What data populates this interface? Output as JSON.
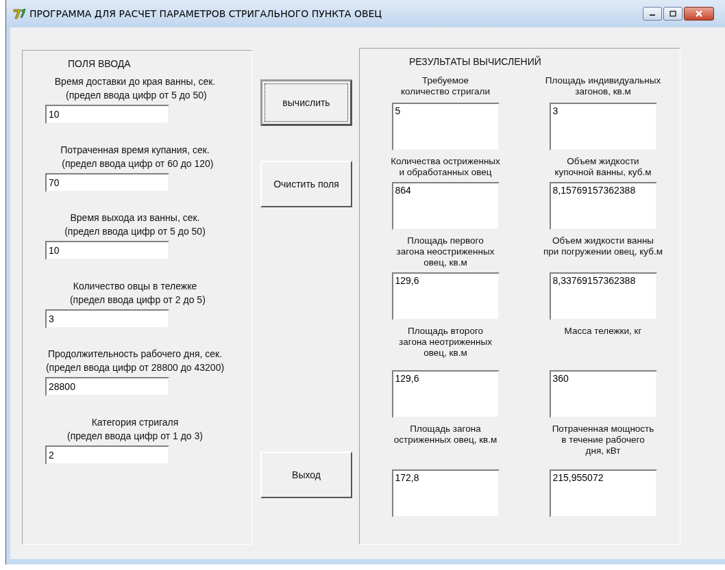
{
  "window": {
    "title": "ПРОГРАММА ДЛЯ РАСЧЕТ ПАРАМЕТРОВ СТРИГАЛЬНОГО ПУНКТА ОВЕЦ"
  },
  "inputs": {
    "title": "ПОЛЯ ВВОДА",
    "fields": [
      {
        "label": "Время доставки до края ванны, сек.\n (предел ввода цифр от 5 до 50)",
        "value": "10"
      },
      {
        "label": "Потраченная время купания, сек.\n  (предел ввода цифр от 60 до 120)",
        "value": "70"
      },
      {
        "label": "Время выхода из ванны, сек.\n(предел ввода цифр от 5 до 50)",
        "value": "10"
      },
      {
        "label": "Количество овцы в тележке\n  (предел ввода цифр от 2 до 5)",
        "value": "3"
      },
      {
        "label": "Продолжительность рабочего дня, сек.\n(предел ввода цифр от 28800 до 43200)",
        "value": "28800"
      },
      {
        "label": "Категория стригаля\n(предел ввода цифр от 1 до 3)",
        "value": "2"
      }
    ]
  },
  "buttons": [
    {
      "label": "вычислить",
      "default": true
    },
    {
      "label": "Очистить поля",
      "default": false
    },
    {
      "label": "Выход",
      "default": false
    }
  ],
  "results": {
    "title": "РЕЗУЛЬТАТЫ ВЫЧИСЛЕНИЙ",
    "items": [
      {
        "label": "Требуемое\nколичество стригали",
        "value": "5"
      },
      {
        "label": "Площадь индивидуальных\nзагонов, кв.м",
        "value": "3"
      },
      {
        "label": "Количества остриженных\nи обработанных овец",
        "value": "864"
      },
      {
        "label": "Объем жидкости\nкупочной ванны, куб.м",
        "value": "8,15769157362388"
      },
      {
        "label": "Площадь первого\nзагона неостриженных\nовец, кв.м",
        "value": "129,6"
      },
      {
        "label": "Объем жидкости ванны\nпри погружении овец, куб.м",
        "value": "8,33769157362388"
      },
      {
        "label": "Площадь второго\nзагона неотриженных\nовец, кв.м",
        "value": "129,6"
      },
      {
        "label": "Масса тележки, кг",
        "value": "360"
      },
      {
        "label": "Площадь загона\nостриженных овец, кв.м",
        "value": "172,8"
      },
      {
        "label": "Потраченная мощность\nв течение рабочего\nдня, кВт",
        "value": "215,955072"
      }
    ]
  }
}
